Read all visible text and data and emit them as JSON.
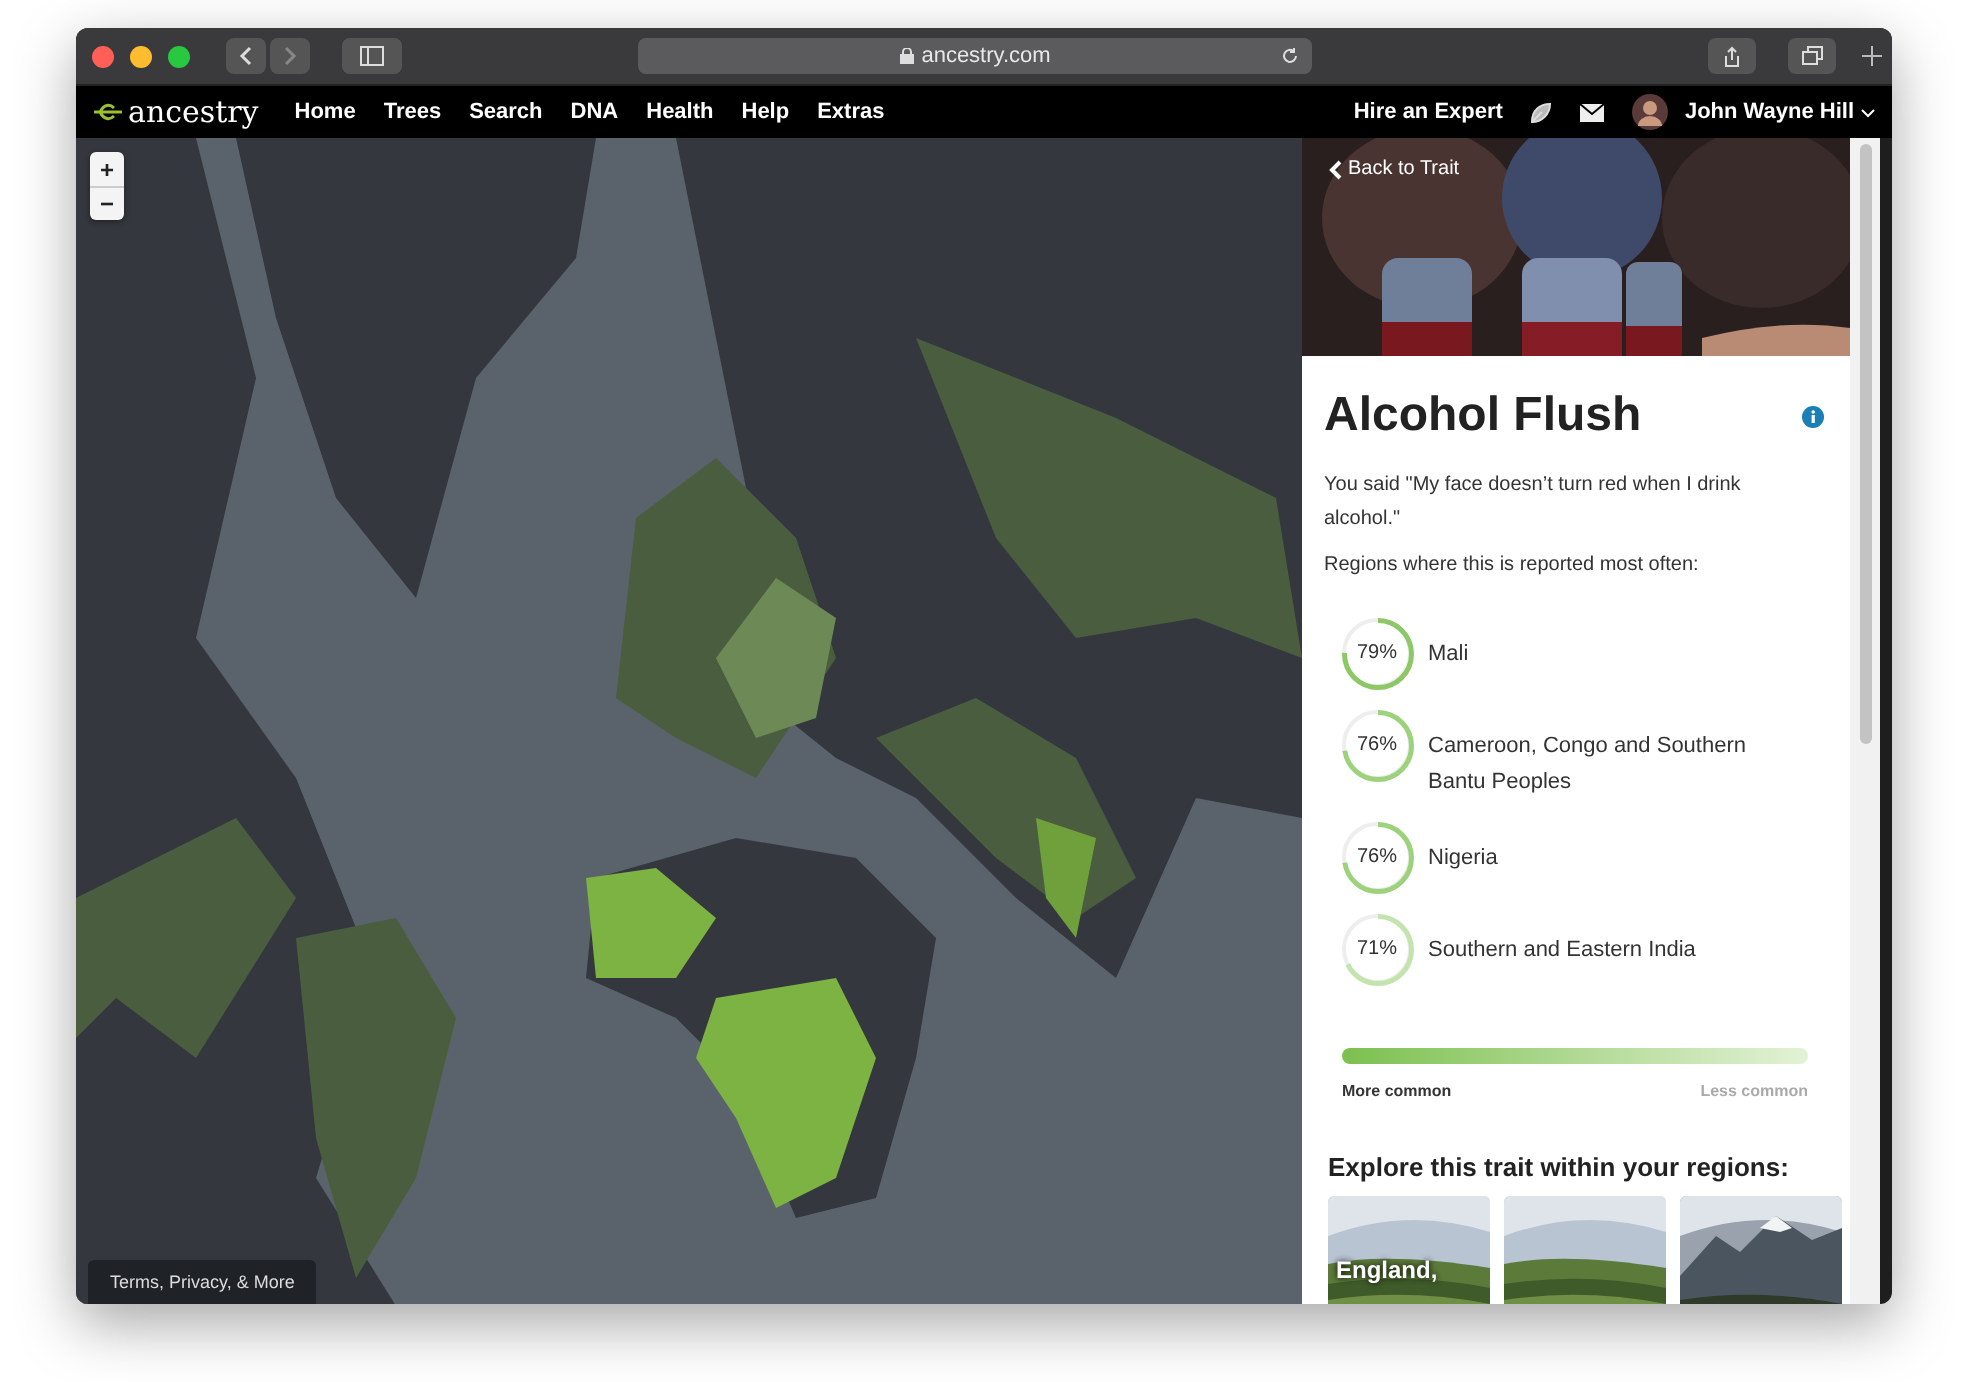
{
  "browser": {
    "url": "ancestry.com"
  },
  "nav": {
    "logo": "ancestry",
    "links": [
      "Home",
      "Trees",
      "Search",
      "DNA",
      "Health",
      "Help",
      "Extras"
    ],
    "hire": "Hire an Expert",
    "user": "John Wayne Hill"
  },
  "map": {
    "zoom_in": "+",
    "zoom_out": "−",
    "footer": "Terms, Privacy, & More"
  },
  "panel": {
    "back": "Back to Trait",
    "title": "Alcohol Flush",
    "statement": "You said \"My face doesn’t turn red when I drink alcohol.\"",
    "regions_label": "Regions where this is reported most often:",
    "regions": [
      {
        "percent": "79%",
        "name": "Mali",
        "level": 0.79,
        "color": "#8cc866"
      },
      {
        "percent": "76%",
        "name": "Cameroon, Congo and Southern Bantu Peoples",
        "level": 0.76,
        "color": "#9dd27c"
      },
      {
        "percent": "76%",
        "name": "Nigeria",
        "level": 0.76,
        "color": "#9dd27c"
      },
      {
        "percent": "71%",
        "name": "Southern and Eastern India",
        "level": 0.71,
        "color": "#c4e4ae"
      }
    ],
    "legend": {
      "more": "More common",
      "less": "Less common"
    },
    "explore_title": "Explore this trait within your regions:",
    "cards": [
      {
        "kind": "picture",
        "label": "England,"
      },
      {
        "kind": "picture"
      },
      {
        "kind": "picture"
      }
    ]
  }
}
